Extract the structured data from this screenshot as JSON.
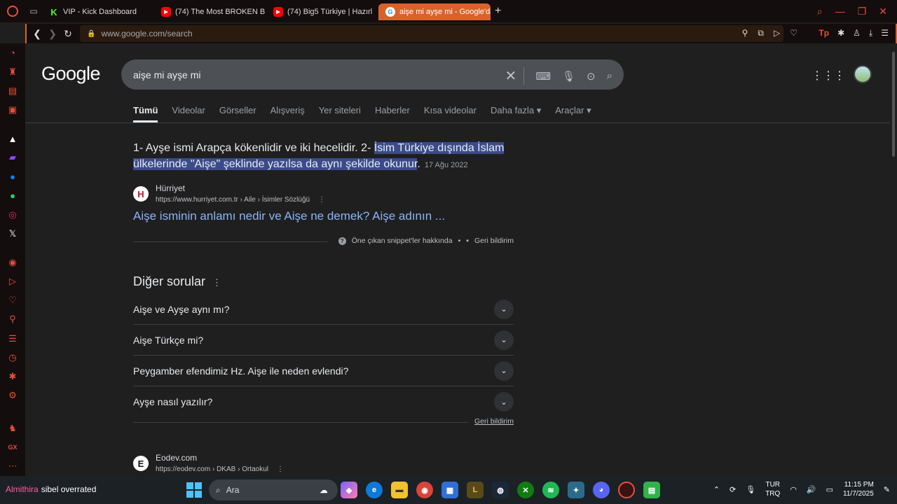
{
  "browser": {
    "tabs": [
      {
        "label": "VIP - Kick Dashboard",
        "icon": "kick-icon"
      },
      {
        "label": "(74) The Most BROKEN B",
        "icon": "youtube-icon"
      },
      {
        "label": "(74) Big5 Türkiye | Hazırl",
        "icon": "youtube-icon"
      },
      {
        "label": "aişe mi ayşe mi - Google'da",
        "icon": "google-icon",
        "active": true
      }
    ],
    "url": "www.google.com/search"
  },
  "google": {
    "logo": "Google",
    "query": "aişe mi ayşe mi",
    "filters": [
      "Tümü",
      "Videolar",
      "Görseller",
      "Alışveriş",
      "Yer siteleri",
      "Haberler",
      "Kısa videolar",
      "Daha fazla",
      "Araçlar"
    ],
    "snippet": {
      "text_plain": "1- Ayşe ismi Arapça kökenlidir ve iki hecelidir. 2- ",
      "text_highlight": "İsim Türkiye dışında İslam ülkelerinde \"Aişe\" şeklinde yazılsa da aynı şekilde okunur",
      "text_end": ".",
      "date": "17 Ağu 2022",
      "source_name": "Hürriyet",
      "source_fav": "H",
      "source_cite": "https://www.hurriyet.com.tr › Aile › İsimler Sözlüğü",
      "link": "Aişe isminin anlamı nedir ve Aişe ne demek? Aişe adının ...",
      "about": "Öne çıkan snippet'ler hakkında",
      "feedback": "Geri bildirim"
    },
    "paa": {
      "title": "Diğer sorular",
      "items": [
        "Aişe ve Ayşe aynı mı?",
        "Aişe Türkçe mi?",
        "Peygamber efendimiz Hz. Aişe ile neden evlendi?",
        "Ayşe nasıl yazılır?"
      ],
      "feedback": "Geri bildirim"
    },
    "result2": {
      "name": "Eodev.com",
      "fav": "E",
      "cite": "https://eodev.com › DKAB › Ortaokul"
    }
  },
  "taskbar": {
    "user": "Almithira",
    "message": "sibel overrated",
    "search_placeholder": "Ara",
    "lang1": "TUR",
    "lang2": "TRQ",
    "time": "11:15 PM",
    "date": "11/7/2025"
  }
}
